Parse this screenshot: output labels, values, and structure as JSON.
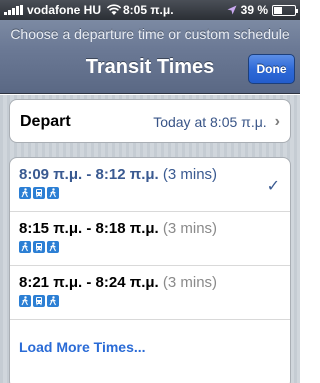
{
  "status_bar": {
    "carrier": "vodafone HU",
    "time": "8:05 π.μ.",
    "battery": "39 %",
    "battery_level": 0.39
  },
  "nav": {
    "prompt": "Choose a departure time or custom schedule",
    "title": "Transit Times",
    "done_label": "Done"
  },
  "depart": {
    "label": "Depart",
    "value": "Today at 8:05 π.μ."
  },
  "times": [
    {
      "range": "8:09 π.μ. - 8:12 π.μ.",
      "duration": "(3 mins)",
      "selected": true,
      "modes": [
        "walk-icon",
        "bus-icon",
        "walk-icon"
      ]
    },
    {
      "range": "8:15 π.μ. - 8:18 π.μ.",
      "duration": "(3 mins)",
      "selected": false,
      "modes": [
        "walk-icon",
        "bus-icon",
        "walk-icon"
      ]
    },
    {
      "range": "8:21 π.μ. - 8:24 π.μ.",
      "duration": "(3 mins)",
      "selected": false,
      "modes": [
        "walk-icon",
        "bus-icon",
        "walk-icon"
      ]
    }
  ],
  "load_more": "Load More Times...",
  "colors": {
    "accent": "#2a6bd6",
    "selected_text": "#3a5a91",
    "nav_bar": "#6b7995",
    "mode_icon": "#2c7fd4"
  }
}
